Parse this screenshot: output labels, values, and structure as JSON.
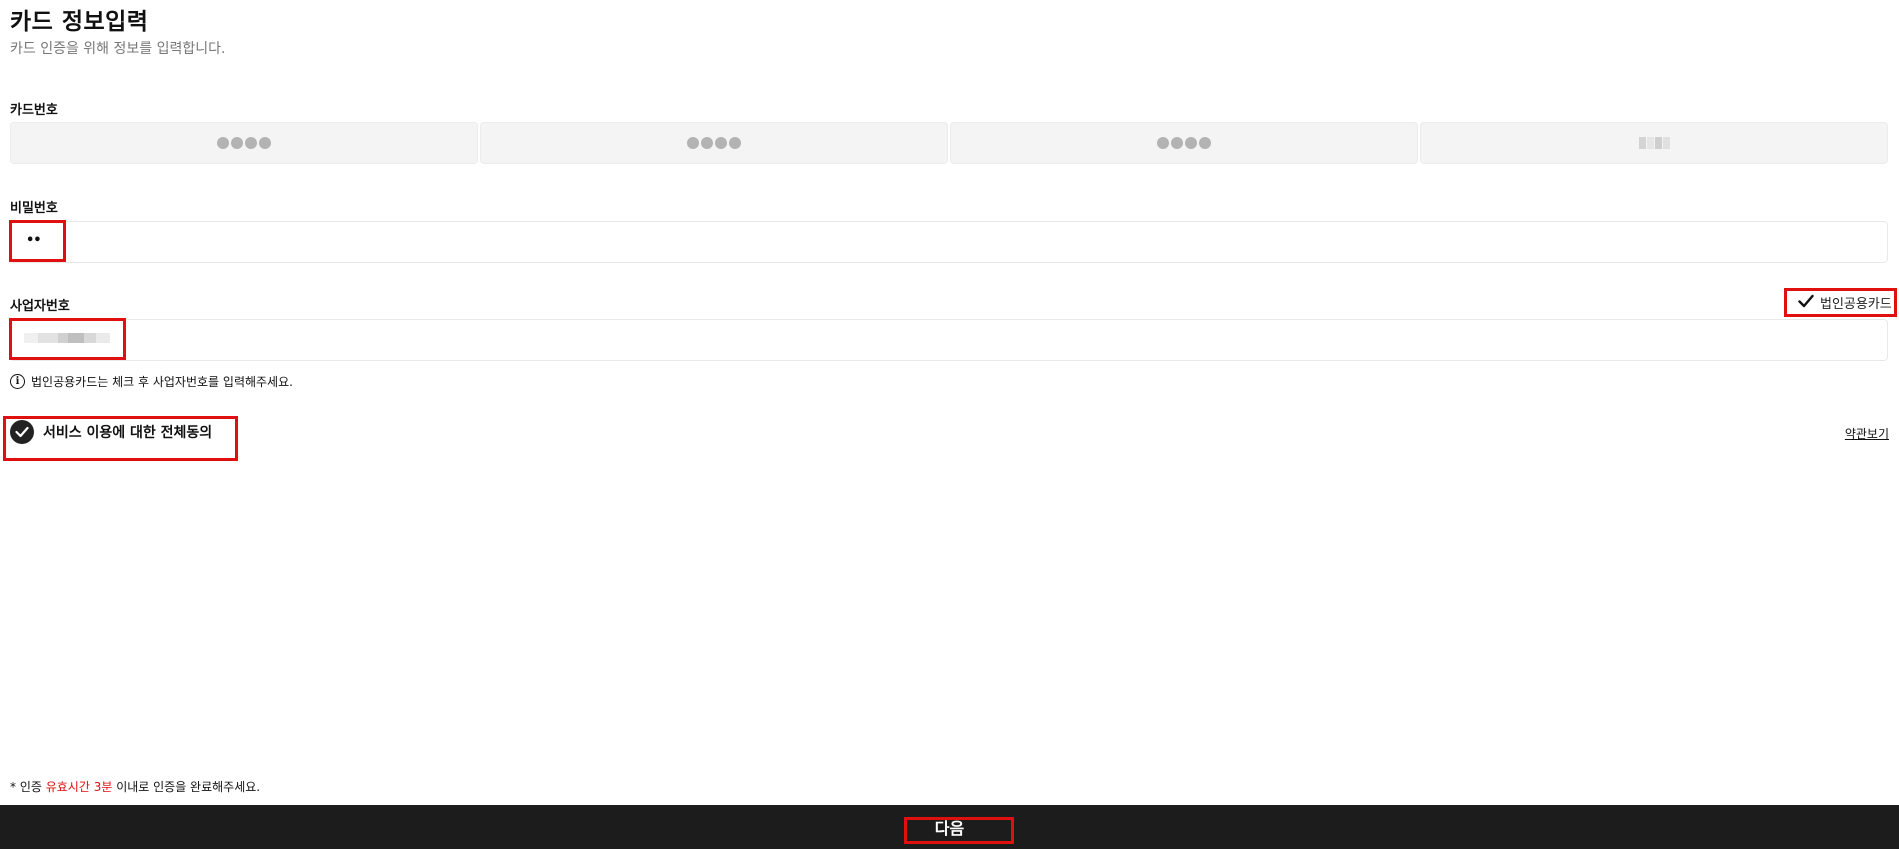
{
  "header": {
    "title": "카드 정보입력",
    "subtitle": "카드 인증을 위해 정보를 입력합니다."
  },
  "card_number": {
    "label": "카드번호",
    "segments": [
      "●●●●",
      "●●●●",
      "●●●●",
      ""
    ]
  },
  "password": {
    "label": "비밀번호",
    "value": "••"
  },
  "business_number": {
    "label": "사업자번호",
    "corporate_card_label": "법인공용카드",
    "corporate_card_checked": true,
    "info_text": "법인공용카드는 체크 후 사업자번호를 입력해주세요."
  },
  "agreement": {
    "label": "서비스 이용에 대한 전체동의",
    "checked": true,
    "terms_link": "약관보기"
  },
  "notice": {
    "prefix": "* 인증 ",
    "highlight": "유효시간 3분",
    "suffix": " 이내로 인증을 완료해주세요."
  },
  "footer": {
    "next_label": "다음"
  },
  "colors": {
    "accent_red": "#e01010",
    "bottom_bar": "#1c1c1c",
    "input_bg": "#f4f4f4"
  }
}
